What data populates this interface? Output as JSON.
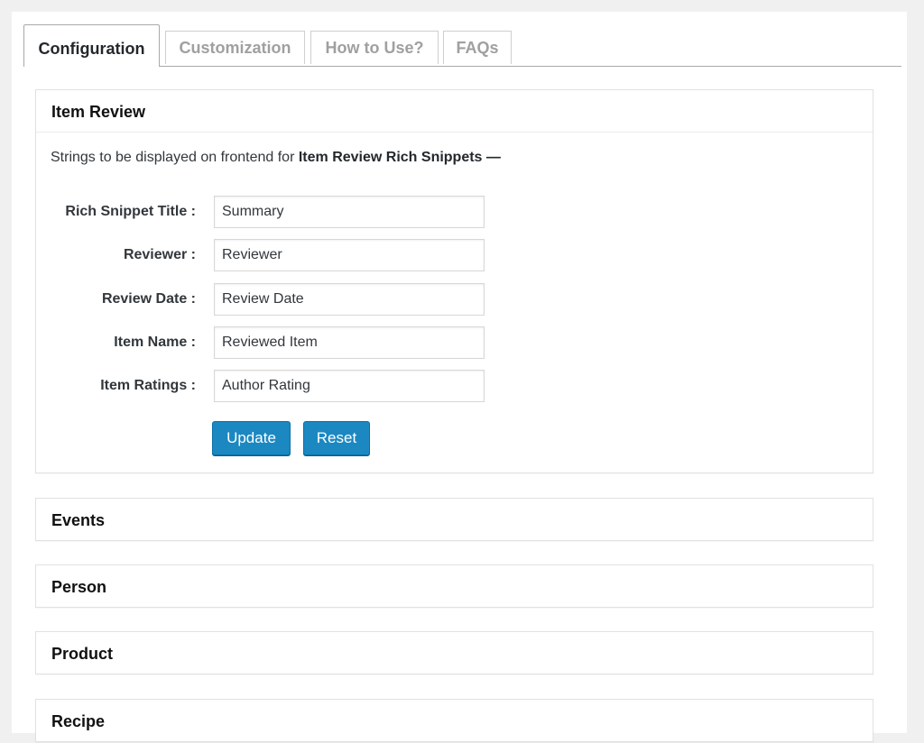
{
  "tabs": [
    {
      "label": "Configuration",
      "active": true
    },
    {
      "label": "Customization",
      "active": false
    },
    {
      "label": "How to Use?",
      "active": false
    },
    {
      "label": "FAQs",
      "active": false
    }
  ],
  "item_review": {
    "title": "Item Review",
    "intro_prefix": "Strings to be displayed on frontend for ",
    "intro_bold": "Item Review Rich Snippets",
    "intro_suffix": " —",
    "fields": [
      {
        "label": "Rich Snippet Title :",
        "value": "Summary"
      },
      {
        "label": "Reviewer :",
        "value": "Reviewer"
      },
      {
        "label": "Review Date :",
        "value": "Review Date"
      },
      {
        "label": "Item Name :",
        "value": "Reviewed Item"
      },
      {
        "label": "Item Ratings :",
        "value": "Author Rating"
      }
    ],
    "update_label": "Update",
    "reset_label": "Reset"
  },
  "sections": [
    {
      "title": "Events"
    },
    {
      "title": "Person"
    },
    {
      "title": "Product"
    },
    {
      "title": "Recipe"
    }
  ],
  "colors": {
    "button": "#1c88c1",
    "page_background": "#f0f0f0"
  }
}
